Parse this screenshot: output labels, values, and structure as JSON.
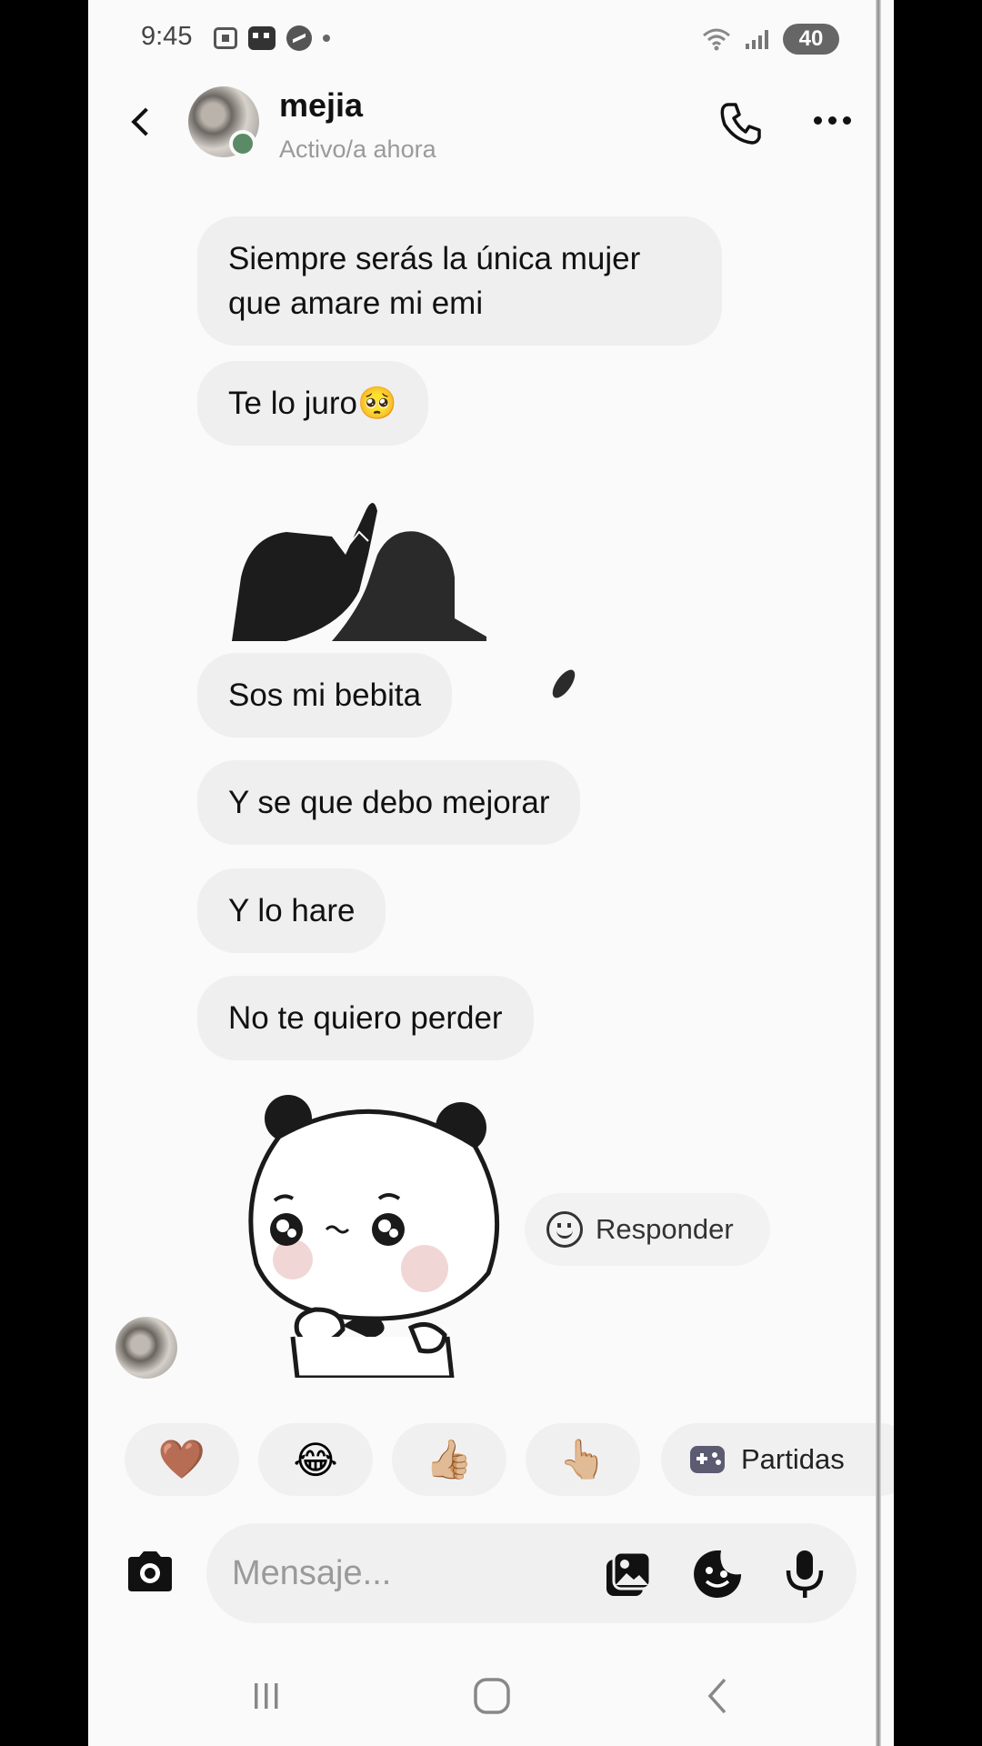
{
  "status_bar": {
    "time": "9:45",
    "battery": "40"
  },
  "header": {
    "contact_name": "mejia",
    "contact_status": "Activo/a ahora"
  },
  "messages": [
    {
      "type": "text",
      "text": "Siempre serás la única mujer que amare mi emi"
    },
    {
      "type": "text",
      "text": "Te lo juro🥺"
    },
    {
      "type": "sticker",
      "sticker": "pinky-promise-hands"
    },
    {
      "type": "text",
      "text": "Sos mi bebita"
    },
    {
      "type": "text",
      "text": "Y se que debo mejorar"
    },
    {
      "type": "text",
      "text": "Y lo hare"
    },
    {
      "type": "text",
      "text": "No te quiero perder"
    },
    {
      "type": "sticker",
      "sticker": "sad-panda"
    }
  ],
  "reply_button": {
    "label": "Responder"
  },
  "quick_reactions": {
    "items": [
      "🤎",
      "😂",
      "👍🏼",
      "👆🏼"
    ],
    "games_label": "Partidas"
  },
  "composer": {
    "placeholder": "Mensaje..."
  },
  "colors": {
    "background": "#fafafa",
    "bubble": "#efefef",
    "online_dot": "#5b8a66"
  }
}
